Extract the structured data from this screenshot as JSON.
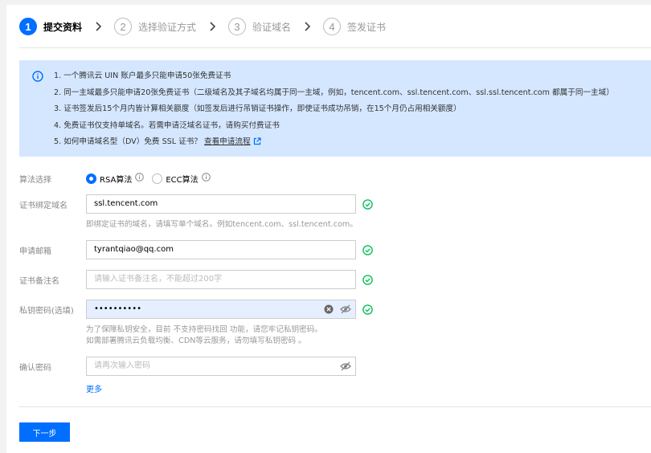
{
  "steps": [
    {
      "num": "1",
      "label": "提交资料"
    },
    {
      "num": "2",
      "label": "选择验证方式"
    },
    {
      "num": "3",
      "label": "验证域名"
    },
    {
      "num": "4",
      "label": "签发证书"
    }
  ],
  "notice": {
    "items": [
      "1. 一个腾讯云 UIN 账户最多只能申请50张免费证书",
      "2. 同一主域最多只能申请20张免费证书（二级域名及其子域名均属于同一主域，例如，tencent.com、ssl.tencent.com、ssl.ssl.tencent.com 都属于同一主域）",
      "3. 证书签发后15个月内皆计算相关额度（如签发后进行吊销证书操作，即使证书成功吊销，在15个月仍占用相关额度）",
      "4. 免费证书仅支持单域名。若需申请泛域名证书，请购买付费证书"
    ],
    "last_item": "5. 如何申请域名型（DV）免费 SSL 证书？",
    "last_link": "查看申请流程"
  },
  "form": {
    "algorithm_label": "算法选择",
    "rsa_label": "RSA算法",
    "ecc_label": "ECC算法",
    "domain_label": "证书绑定域名",
    "domain_value": "ssl.tencent.com",
    "domain_help": "即绑定证书的域名，请填写单个域名。例如tencent.com、ssl.tencent.com。",
    "email_label": "申请邮箱",
    "email_value": "tyrantqiao@qq.com",
    "remark_label": "证书备注名",
    "remark_placeholder": "请输入证书备注名，不能超过200字",
    "password_label": "私钥密码(选填)",
    "password_value": "••••••••••",
    "password_help_1": "为了保障私钥安全，目前 不支持密码找回 功能，请您牢记私钥密码。",
    "password_help_2": "如需部署腾讯云负载均衡、CDN等云服务，请勿填写私钥密码 。",
    "confirm_label": "确认密码",
    "confirm_placeholder": "请再次输入密码",
    "more_label": "更多"
  },
  "next_button": "下一步",
  "colors": {
    "accent": "#006eff",
    "success": "#0abf5b",
    "notice_bg": "#d5e7ff"
  }
}
